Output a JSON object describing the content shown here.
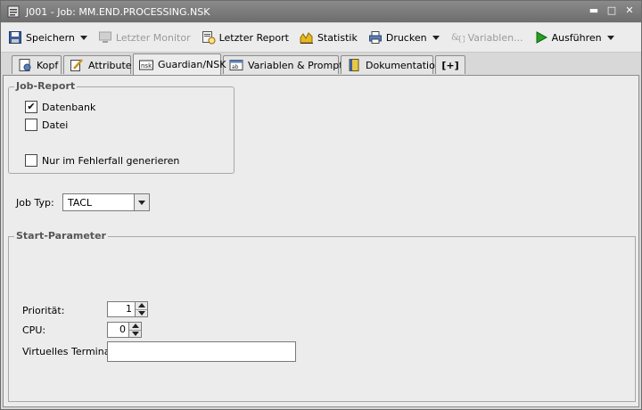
{
  "window": {
    "title": "J001 - Job: MM.END.PROCESSING.NSK",
    "minimize_label": "▬",
    "maximize_label": "□",
    "close_label": "✕"
  },
  "toolbar": {
    "save_label": "Speichern",
    "last_monitor_label": "Letzter Monitor",
    "last_report_label": "Letzter Report",
    "statistics_label": "Statistik",
    "print_label": "Drucken",
    "variables_label": "Variablen...",
    "execute_label": "Ausführen"
  },
  "tabs": [
    {
      "label": "Kopf"
    },
    {
      "label": "Attribute"
    },
    {
      "label": "Guardian/NSK",
      "active": true
    },
    {
      "label": "Variablen & Prompts"
    },
    {
      "label": "Dokumentation"
    },
    {
      "label": "[+]"
    }
  ],
  "job_report": {
    "title": "Job-Report",
    "database_label": "Datenbank",
    "database_checked": true,
    "database_mark": "✔",
    "file_label": "Datei",
    "file_checked": false,
    "on_error_label": "Nur im Fehlerfall generieren",
    "on_error_checked": false
  },
  "job_type": {
    "label": "Job Typ:",
    "value": "TACL"
  },
  "start_parameters": {
    "title": "Start-Parameter",
    "priority_label": "Priorität:",
    "priority_value": "1",
    "cpu_label": "CPU:",
    "cpu_value": "0",
    "virtual_terminal_label": "Virtuelles Terminal:",
    "virtual_terminal_value": ""
  },
  "colors": {
    "titlebar": "#7a7a7a",
    "background": "#ececec",
    "execute_icon": "#22a022"
  }
}
